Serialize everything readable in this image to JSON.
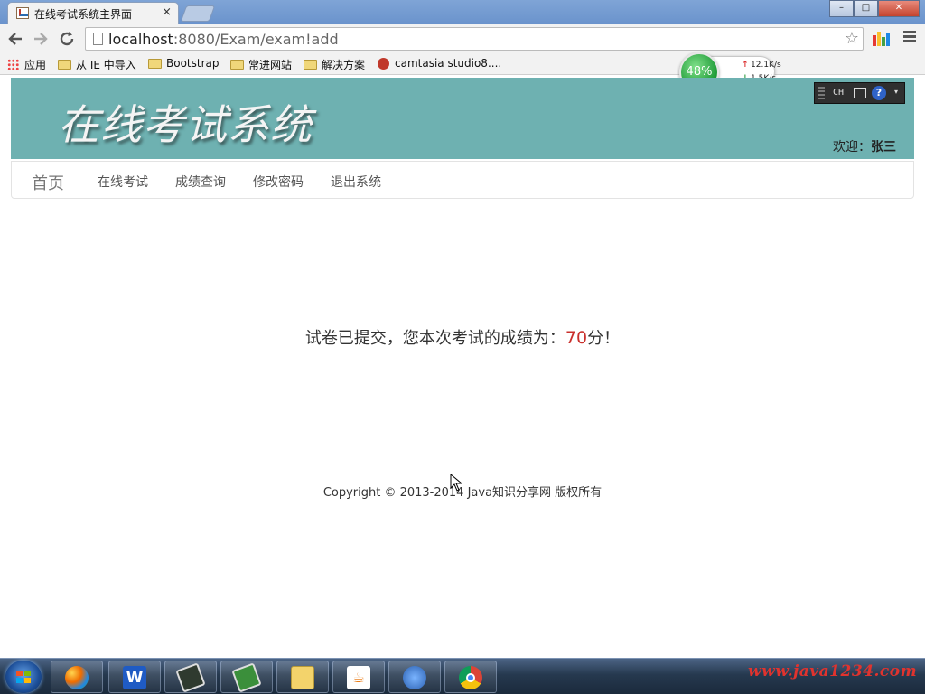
{
  "browser": {
    "tab_title": "在线考试系统主界面",
    "tab_close": "×",
    "url_host": "localhost",
    "url_rest": ":8080/Exam/exam!add",
    "back_icon": "back-arrow",
    "forward_icon": "forward-arrow",
    "reload_icon": "reload",
    "star_icon": "☆",
    "window_buttons": [
      "–",
      "□",
      "✕"
    ],
    "bookmarks": [
      {
        "label": "应用",
        "icon": "apps-grid-icon"
      },
      {
        "label": "从 IE 中导入",
        "icon": "folder-icon"
      },
      {
        "label": "Bootstrap",
        "icon": "folder-icon"
      },
      {
        "label": "常进网站",
        "icon": "folder-icon"
      },
      {
        "label": "解决方案",
        "icon": "folder-icon"
      },
      {
        "label": "camtasia studio8....",
        "icon": "camtasia-icon"
      }
    ]
  },
  "net_meter": {
    "percent": "48%",
    "upload": "12.1K/s",
    "download": "1.5K/s",
    "ball_color": "#2aa845"
  },
  "ime_bar": {
    "lang": "CH",
    "help": "?"
  },
  "site": {
    "title": "在线考试系统",
    "welcome_label": "欢迎：",
    "username": "张三",
    "banner_color": "#6eb1b1",
    "nav": {
      "brand": "首页",
      "links": [
        "在线考试",
        "成绩查询",
        "修改密码",
        "退出系统"
      ]
    },
    "result": {
      "prefix": "试卷已提交，您本次考试的成绩为：",
      "score": "70",
      "suffix": "分！",
      "score_color": "#c9302c"
    },
    "footer": "Copyright © 2013-2014 Java知识分享网 版权所有"
  },
  "taskbar": {
    "apps": [
      "windows-start",
      "app-launcher",
      "wps-writer",
      "terminal",
      "tool",
      "file-explorer",
      "java",
      "dolphin-browser",
      "chrome"
    ],
    "watermark": "www.java1234.com"
  }
}
